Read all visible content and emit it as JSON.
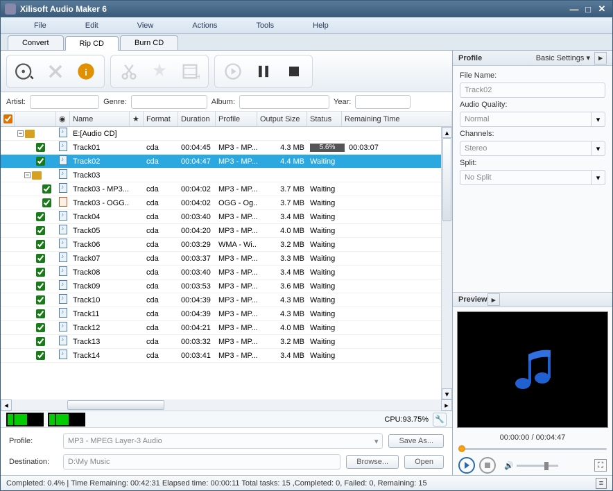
{
  "window": {
    "title": "Xilisoft Audio Maker 6"
  },
  "menu": {
    "file": "File",
    "edit": "Edit",
    "view": "View",
    "actions": "Actions",
    "tools": "Tools",
    "help": "Help"
  },
  "tabs": {
    "convert": "Convert",
    "rip": "Rip CD",
    "burn": "Burn CD"
  },
  "meta": {
    "artist": "Artist:",
    "genre": "Genre:",
    "album": "Album:",
    "year": "Year:"
  },
  "grid": {
    "headers": {
      "name": "Name",
      "format": "Format",
      "duration": "Duration",
      "profile": "Profile",
      "outputsize": "Output Size",
      "status": "Status",
      "remaining": "Remaining Time"
    },
    "root": "E:[Audio CD]",
    "t03": {
      "name": "Track03",
      "c1": "Track03 - MP3...",
      "c2": "Track03 - OGG..."
    },
    "rows": [
      {
        "name": "Track01",
        "format": "cda",
        "duration": "00:04:45",
        "profile": "MP3 - MP...",
        "size": "4.3 MB",
        "status": "5.6%",
        "remaining": "00:03:07",
        "progress": true
      },
      {
        "name": "Track02",
        "format": "cda",
        "duration": "00:04:47",
        "profile": "MP3 - MP...",
        "size": "4.4 MB",
        "status": "Waiting",
        "remaining": "",
        "sel": true
      },
      {
        "name": "Track03 - MP3...",
        "format": "cda",
        "duration": "00:04:02",
        "profile": "MP3 - MP...",
        "size": "3.7 MB",
        "status": "Waiting",
        "remaining": "",
        "indent": true
      },
      {
        "name": "Track03 - OGG...",
        "format": "cda",
        "duration": "00:04:02",
        "profile": "OGG - Og...",
        "size": "3.7 MB",
        "status": "Waiting",
        "remaining": "",
        "indent": true,
        "ogg": true
      },
      {
        "name": "Track04",
        "format": "cda",
        "duration": "00:03:40",
        "profile": "MP3 - MP...",
        "size": "3.4 MB",
        "status": "Waiting",
        "remaining": ""
      },
      {
        "name": "Track05",
        "format": "cda",
        "duration": "00:04:20",
        "profile": "MP3 - MP...",
        "size": "4.0 MB",
        "status": "Waiting",
        "remaining": ""
      },
      {
        "name": "Track06",
        "format": "cda",
        "duration": "00:03:29",
        "profile": "WMA - Wi...",
        "size": "3.2 MB",
        "status": "Waiting",
        "remaining": ""
      },
      {
        "name": "Track07",
        "format": "cda",
        "duration": "00:03:37",
        "profile": "MP3 - MP...",
        "size": "3.3 MB",
        "status": "Waiting",
        "remaining": ""
      },
      {
        "name": "Track08",
        "format": "cda",
        "duration": "00:03:40",
        "profile": "MP3 - MP...",
        "size": "3.4 MB",
        "status": "Waiting",
        "remaining": ""
      },
      {
        "name": "Track09",
        "format": "cda",
        "duration": "00:03:53",
        "profile": "MP3 - MP...",
        "size": "3.6 MB",
        "status": "Waiting",
        "remaining": ""
      },
      {
        "name": "Track10",
        "format": "cda",
        "duration": "00:04:39",
        "profile": "MP3 - MP...",
        "size": "4.3 MB",
        "status": "Waiting",
        "remaining": ""
      },
      {
        "name": "Track11",
        "format": "cda",
        "duration": "00:04:39",
        "profile": "MP3 - MP...",
        "size": "4.3 MB",
        "status": "Waiting",
        "remaining": ""
      },
      {
        "name": "Track12",
        "format": "cda",
        "duration": "00:04:21",
        "profile": "MP3 - MP...",
        "size": "4.0 MB",
        "status": "Waiting",
        "remaining": ""
      },
      {
        "name": "Track13",
        "format": "cda",
        "duration": "00:03:32",
        "profile": "MP3 - MP...",
        "size": "3.2 MB",
        "status": "Waiting",
        "remaining": ""
      },
      {
        "name": "Track14",
        "format": "cda",
        "duration": "00:03:41",
        "profile": "MP3 - MP...",
        "size": "3.4 MB",
        "status": "Waiting",
        "remaining": ""
      }
    ]
  },
  "cpu": {
    "label": "CPU:93.75%"
  },
  "bottom": {
    "profile_lbl": "Profile:",
    "profile_val": "MP3 - MPEG Layer-3 Audio",
    "saveas": "Save As...",
    "dest_lbl": "Destination:",
    "dest_val": "D:\\My Music",
    "browse": "Browse...",
    "open": "Open"
  },
  "profile": {
    "header": "Profile",
    "basic": "Basic Settings ▾",
    "filename_lbl": "File Name:",
    "filename_val": "Track02",
    "quality_lbl": "Audio Quality:",
    "quality_val": "Normal",
    "channels_lbl": "Channels:",
    "channels_val": "Stereo",
    "split_lbl": "Split:",
    "split_val": "No Split"
  },
  "preview": {
    "header": "Preview",
    "time": "00:00:00 / 00:04:47"
  },
  "status": {
    "text": "Completed: 0.4% | Time Remaining: 00:42:31 Elapsed time: 00:00:11 Total tasks: 15 ,Completed: 0, Failed: 0, Remaining: 15"
  }
}
